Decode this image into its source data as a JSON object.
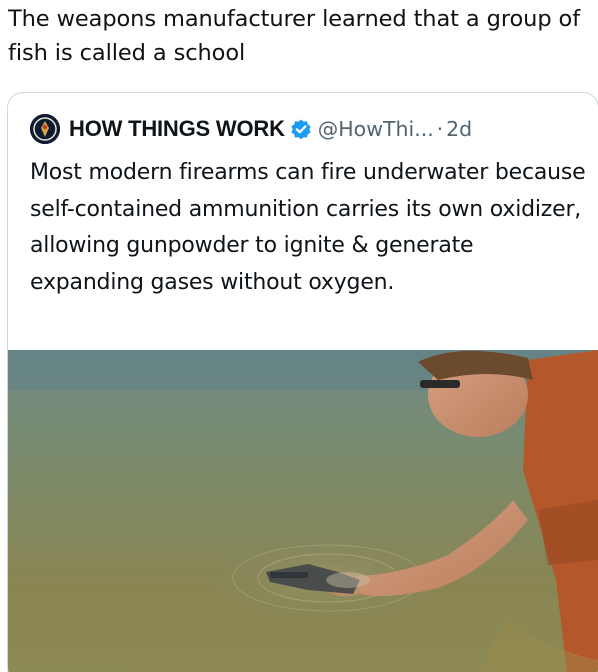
{
  "post": {
    "caption": "The weapons manufacturer learned that a group of fish is called a school"
  },
  "quoted_post": {
    "display_name": "HOW THINGS WORK",
    "handle": "@HowThi...",
    "separator": "·",
    "time": "2d",
    "text": "Most modern firearms can fire underwater because self-contained ammunition carries its own oxidizer, allowing gunpowder to ignite & generate expanding gases without oxygen.",
    "avatar_icon": "globe-emblem-icon",
    "verified_icon": "verified-badge-icon",
    "verified_color": "#1d9bf0"
  },
  "colors": {
    "text_primary": "#0f1419",
    "text_secondary": "#536471",
    "card_border": "#cfd9de"
  }
}
